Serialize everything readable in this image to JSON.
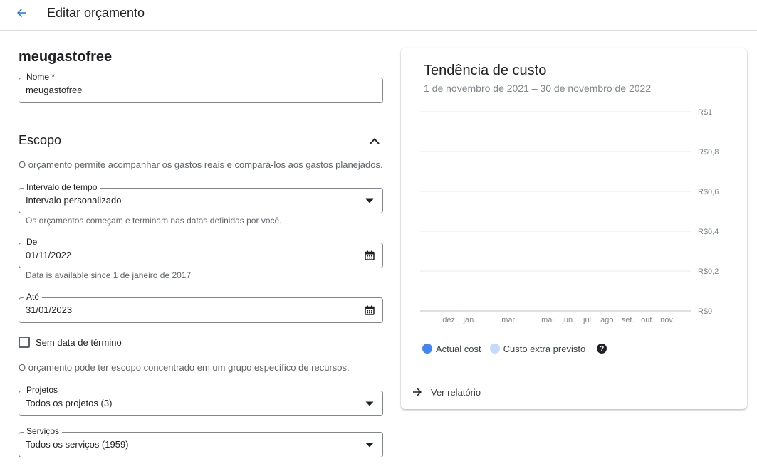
{
  "header": {
    "title": "Editar orçamento",
    "back_icon": "arrow-back-icon"
  },
  "form": {
    "title": "meugastofree",
    "name": {
      "label": "Nome *",
      "value": "meugastofree"
    },
    "scope": {
      "title": "Escopo",
      "description": "O orçamento permite acompanhar os gastos reais e compará-los aos gastos planejados.",
      "time_range": {
        "label": "Intervalo de tempo",
        "value": "Intervalo personalizado",
        "hint": "Os orçamentos começam e terminam nas datas definidas por você."
      },
      "from": {
        "label": "De",
        "value": "01/11/2022",
        "hint": "Data is available since 1 de janeiro de 2017"
      },
      "to": {
        "label": "Até",
        "value": "31/01/2023"
      },
      "no_end_date": {
        "label": "Sem data de término",
        "checked": false
      },
      "resources_description": "O orçamento pode ter escopo concentrado em um grupo específico de recursos.",
      "projects": {
        "label": "Projetos",
        "value": "Todos os projetos (3)"
      },
      "services": {
        "label": "Serviços",
        "value": "Todos os serviços (1959)"
      }
    }
  },
  "card": {
    "title": "Tendência de custo",
    "subtitle": "1 de novembro de 2021 – 30 de novembro de 2022",
    "legend": {
      "actual": "Actual cost",
      "forecast": "Custo extra previsto"
    },
    "report_link": "Ver relatório"
  },
  "colors": {
    "actual": "#4285f4",
    "forecast": "#c6dafc",
    "accent": "#1a73e8"
  },
  "chart_data": {
    "type": "bar",
    "title": "Tendência de custo",
    "subtitle": "1 de novembro de 2021 – 30 de novembro de 2022",
    "x_ticks": [
      "dez.",
      "jan.",
      "mar.",
      "mai.",
      "jun.",
      "jul.",
      "ago.",
      "set.",
      "out.",
      "nov."
    ],
    "y_ticks": [
      "R$1",
      "R$0,8",
      "R$0,6",
      "R$0,4",
      "R$0,2",
      "R$0"
    ],
    "ylim": [
      0,
      1
    ],
    "grid": true,
    "series": [
      {
        "name": "Actual cost",
        "values": []
      },
      {
        "name": "Custo extra previsto",
        "values": []
      }
    ]
  }
}
